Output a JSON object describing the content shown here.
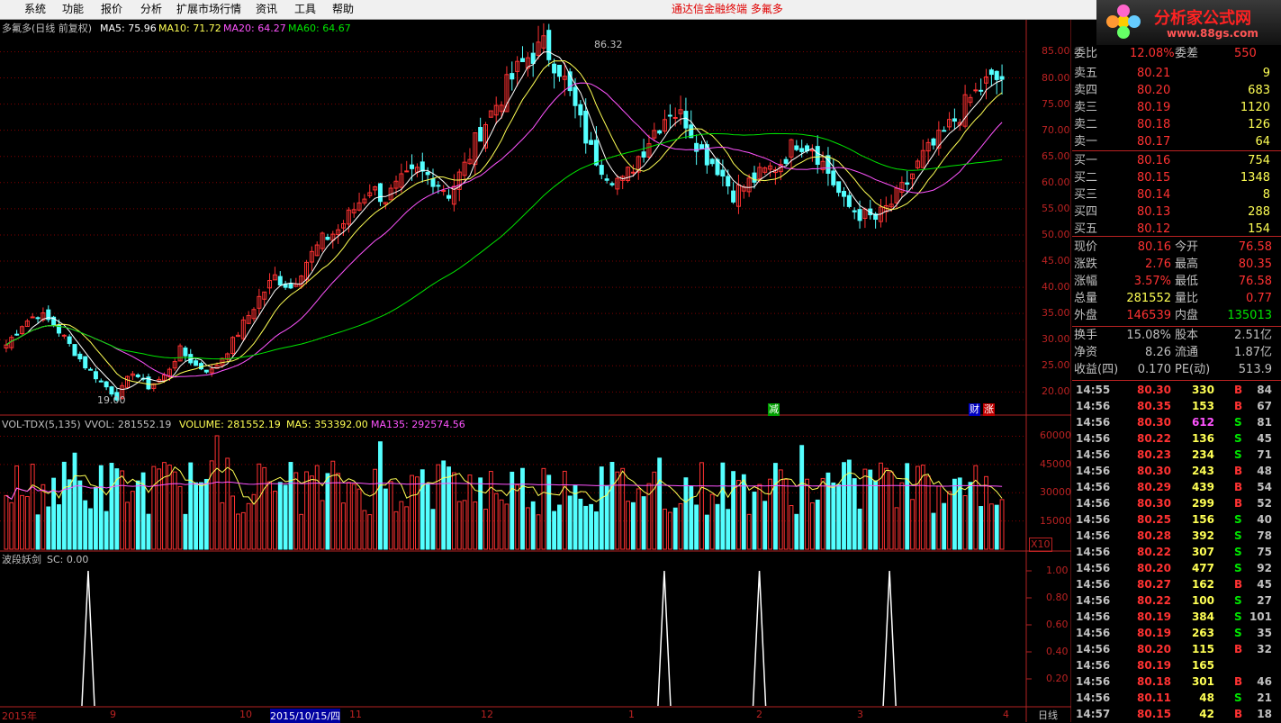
{
  "menu": {
    "items": [
      "系统",
      "功能",
      "报价",
      "分析",
      "扩展市场行情",
      "资讯",
      "工具",
      "帮助"
    ],
    "app_title": "通达信金融终端   多氟多"
  },
  "logo": {
    "text": "分析家公式网",
    "url": "www.88gs.com"
  },
  "main_header": {
    "title": "多氟多(日线 前复权)",
    "ma5": "MA5: 75.96",
    "ma10": "MA10: 71.72",
    "ma20": "MA20: 64.27",
    "ma60": "MA60: 64.67"
  },
  "price_axis": [
    "85.00",
    "80.00",
    "75.00",
    "70.00",
    "65.00",
    "60.00",
    "55.00",
    "50.00",
    "45.00",
    "40.00",
    "35.00",
    "30.00",
    "25.00",
    "20.00"
  ],
  "annotations": {
    "high": "86.32",
    "low": "19.00",
    "jian": "减",
    "cai": "财",
    "zhang": "涨"
  },
  "vol_header": {
    "name": "VOL-TDX(5,135)",
    "vvol": "VVOL: 281552.19",
    "volume": "VOLUME: 281552.19",
    "ma5": "MA5: 353392.00",
    "ma135": "MA135: 292574.56"
  },
  "vol_axis": [
    "60000",
    "45000",
    "30000",
    "15000"
  ],
  "vol_unit": "X10",
  "ind_header": {
    "name": "波段妖剑",
    "sc": "SC: 0.00"
  },
  "ind_axis": [
    "1.00",
    "0.80",
    "0.60",
    "0.40",
    "0.20"
  ],
  "dates": [
    "2015年",
    "9",
    "10",
    "2015/10/15/四",
    "11",
    "12",
    "1",
    "2",
    "3",
    "4"
  ],
  "period": "日线",
  "quote": {
    "wei_bi": {
      "label": "委比",
      "value": "12.08%",
      "label2": "委差",
      "value2": "550"
    },
    "asks": [
      {
        "label": "卖五",
        "price": "80.21",
        "vol": "9"
      },
      {
        "label": "卖四",
        "price": "80.20",
        "vol": "683"
      },
      {
        "label": "卖三",
        "price": "80.19",
        "vol": "1120"
      },
      {
        "label": "卖二",
        "price": "80.18",
        "vol": "126"
      },
      {
        "label": "卖一",
        "price": "80.17",
        "vol": "64"
      }
    ],
    "bids": [
      {
        "label": "买一",
        "price": "80.16",
        "vol": "754"
      },
      {
        "label": "买二",
        "price": "80.15",
        "vol": "1348"
      },
      {
        "label": "买三",
        "price": "80.14",
        "vol": "8"
      },
      {
        "label": "买四",
        "price": "80.13",
        "vol": "288"
      },
      {
        "label": "买五",
        "price": "80.12",
        "vol": "154"
      }
    ],
    "stats": [
      {
        "l1": "现价",
        "v1": "80.16",
        "l2": "今开",
        "v2": "76.58"
      },
      {
        "l1": "涨跌",
        "v1": "2.76",
        "l2": "最高",
        "v2": "80.35"
      },
      {
        "l1": "涨幅",
        "v1": "3.57%",
        "l2": "最低",
        "v2": "76.58"
      },
      {
        "l1": "总量",
        "v1": "281552",
        "l2": "量比",
        "v2": "0.77"
      },
      {
        "l1": "外盘",
        "v1": "146539",
        "l2": "内盘",
        "v2": "135013"
      },
      {
        "l1": "换手",
        "v1": "15.08%",
        "l2": "股本",
        "v2": "2.51亿"
      },
      {
        "l1": "净资",
        "v1": "8.26",
        "l2": "流通",
        "v2": "1.87亿"
      },
      {
        "l1": "收益(四)",
        "v1": "0.170",
        "l2": "PE(动)",
        "v2": "513.9"
      }
    ],
    "ticks": [
      {
        "t": "14:55",
        "p": "80.30",
        "v": "330",
        "d": "B",
        "n": "84"
      },
      {
        "t": "14:56",
        "p": "80.35",
        "v": "153",
        "d": "B",
        "n": "67"
      },
      {
        "t": "14:56",
        "p": "80.30",
        "v": "612",
        "d": "S",
        "n": "81"
      },
      {
        "t": "14:56",
        "p": "80.22",
        "v": "136",
        "d": "S",
        "n": "45"
      },
      {
        "t": "14:56",
        "p": "80.23",
        "v": "234",
        "d": "S",
        "n": "71"
      },
      {
        "t": "14:56",
        "p": "80.30",
        "v": "243",
        "d": "B",
        "n": "48"
      },
      {
        "t": "14:56",
        "p": "80.29",
        "v": "439",
        "d": "B",
        "n": "54"
      },
      {
        "t": "14:56",
        "p": "80.30",
        "v": "299",
        "d": "B",
        "n": "52"
      },
      {
        "t": "14:56",
        "p": "80.25",
        "v": "156",
        "d": "S",
        "n": "40"
      },
      {
        "t": "14:56",
        "p": "80.28",
        "v": "392",
        "d": "S",
        "n": "78"
      },
      {
        "t": "14:56",
        "p": "80.22",
        "v": "307",
        "d": "S",
        "n": "75"
      },
      {
        "t": "14:56",
        "p": "80.20",
        "v": "477",
        "d": "S",
        "n": "92"
      },
      {
        "t": "14:56",
        "p": "80.27",
        "v": "162",
        "d": "B",
        "n": "45"
      },
      {
        "t": "14:56",
        "p": "80.22",
        "v": "100",
        "d": "S",
        "n": "27"
      },
      {
        "t": "14:56",
        "p": "80.19",
        "v": "384",
        "d": "S",
        "n": "101"
      },
      {
        "t": "14:56",
        "p": "80.19",
        "v": "263",
        "d": "S",
        "n": "35"
      },
      {
        "t": "14:56",
        "p": "80.20",
        "v": "115",
        "d": "B",
        "n": "32"
      },
      {
        "t": "14:56",
        "p": "80.19",
        "v": "165",
        "d": "",
        "n": ""
      },
      {
        "t": "14:56",
        "p": "80.18",
        "v": "301",
        "d": "B",
        "n": "46"
      },
      {
        "t": "14:56",
        "p": "80.11",
        "v": "48",
        "d": "S",
        "n": "21"
      },
      {
        "t": "14:57",
        "p": "80.15",
        "v": "42",
        "d": "B",
        "n": "18"
      }
    ]
  },
  "colors": {
    "up": "#ff3232",
    "down": "#54ffff",
    "ma5": "#ffffff",
    "ma10": "#ffff54",
    "ma20": "#ff54ff",
    "ma60": "#00e600",
    "grid": "#800000",
    "axis": "#b22222"
  },
  "chart_data": {
    "type": "candlestick",
    "ylim": [
      18,
      88
    ],
    "close_path": [
      29,
      33,
      35,
      33,
      29,
      25,
      22,
      19,
      24,
      21,
      23,
      28,
      25,
      24,
      28,
      33,
      38,
      42,
      40,
      45,
      49,
      51,
      55,
      59,
      57,
      60,
      62,
      61,
      58,
      63,
      70,
      75,
      80,
      84,
      86,
      82,
      74,
      66,
      62,
      60,
      65,
      70,
      74,
      72,
      66,
      63,
      58,
      60,
      62,
      64,
      68,
      67,
      62,
      56,
      54,
      53,
      56,
      60,
      65,
      68,
      72,
      76,
      79,
      80
    ],
    "spikes_sc": [
      1,
      1,
      1,
      1
    ]
  }
}
